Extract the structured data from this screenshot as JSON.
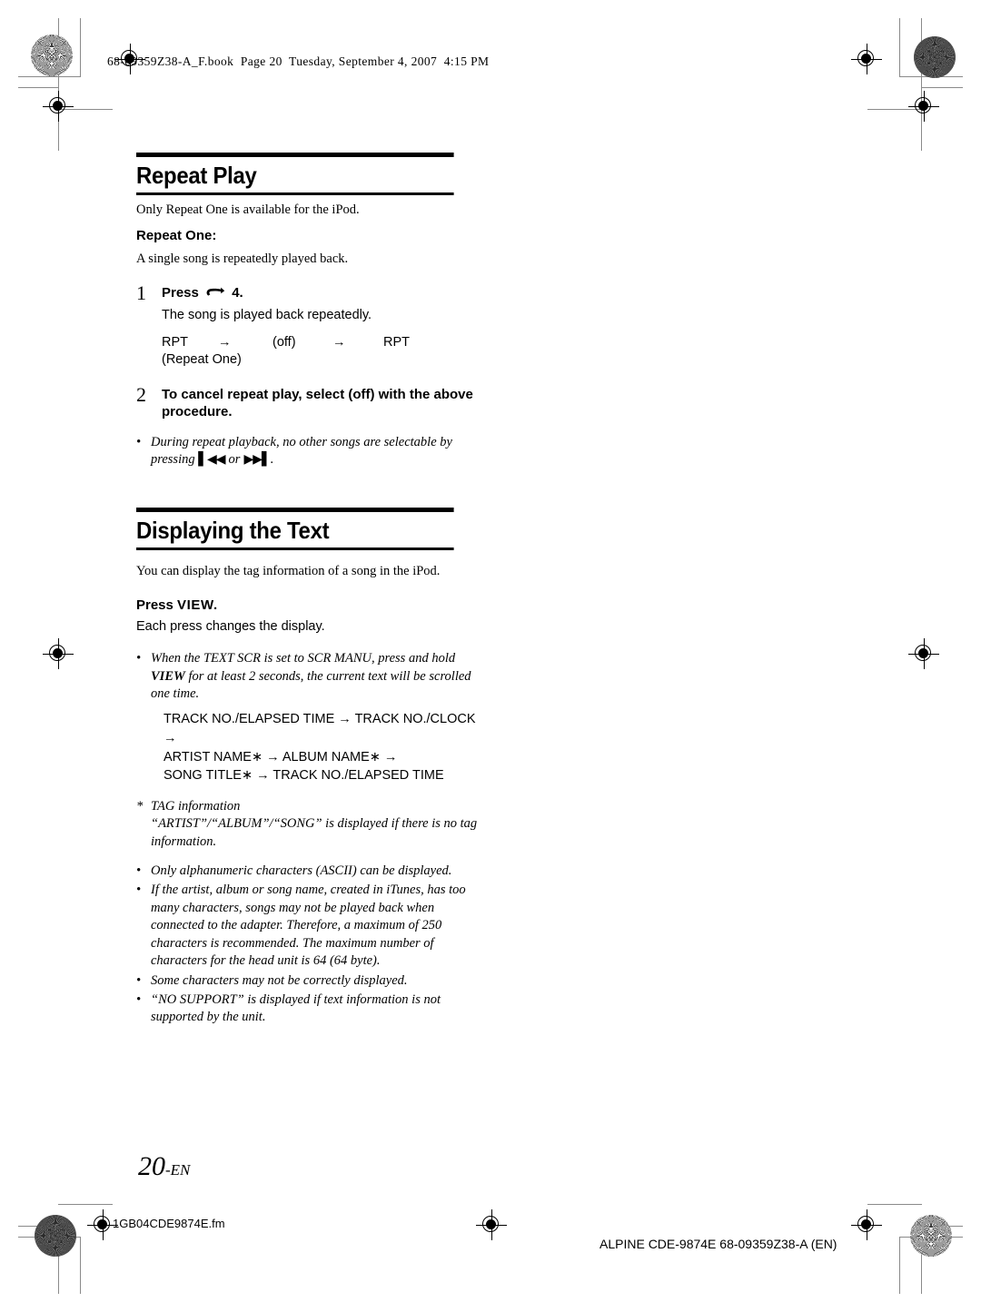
{
  "header": {
    "file_info": "68-09359Z38-A_F.book  Page 20  Tuesday, September 4, 2007  4:15 PM"
  },
  "sections": [
    {
      "title": "Repeat Play",
      "intro": "Only Repeat One is available for the iPod.",
      "subhead": "Repeat One:",
      "subhead_desc": "A single song is repeatedly played back.",
      "steps": [
        {
          "number": "1",
          "head_before_icon": "Press",
          "icon": "repeat-loop-icon",
          "head_after_icon": "4.",
          "sub": "The song is played back repeatedly.",
          "sequence": {
            "row1": [
              "RPT",
              "→",
              "(off)",
              "→",
              "RPT"
            ],
            "row2": "(Repeat One)"
          }
        },
        {
          "number": "2",
          "head": "To cancel repeat play, select (off) with the above procedure."
        }
      ],
      "notes": [
        {
          "mark": "•",
          "text_before_glyphs": "During repeat playback, no other songs are selectable by pressing ",
          "glyph_prev": "▌◀◀",
          "glyph_or": "or",
          "glyph_next": "▶▶▌",
          "text_after_glyphs": "."
        }
      ]
    },
    {
      "title": "Displaying the Text",
      "intro": "You can display the tag information of a song in the iPod.",
      "press_label_1": "Press ",
      "press_label_2": "VIEW.",
      "press_desc": "Each press changes the display.",
      "scroll_note": {
        "mark": "•",
        "part1": "When the TEXT SCR is set to SCR MANU, press and hold ",
        "bold": "VIEW",
        "part2": " for at least 2 seconds, the current text will be scrolled one time."
      },
      "display_sequence": [
        "TRACK NO./ELAPSED TIME → TRACK NO./CLOCK →",
        "ARTIST NAME∗ → ALBUM NAME∗ →",
        "SONG TITLE∗ → TRACK NO./ELAPSED TIME"
      ],
      "footnote": {
        "mark": "*",
        "line1": "TAG information",
        "line2": "“ARTIST”/“ALBUM”/“SONG” is displayed if there is no tag information."
      },
      "notes": [
        {
          "mark": "•",
          "text": "Only alphanumeric characters (ASCII) can be displayed."
        },
        {
          "mark": "•",
          "text": "If the artist, album or song name, created in iTunes, has too many characters, songs may not be played back when connected to the adapter. Therefore, a maximum of 250 characters is recommended. The maximum number of characters for the head unit is 64 (64 byte)."
        },
        {
          "mark": "•",
          "text": "Some characters may not be correctly displayed."
        },
        {
          "mark": "•",
          "text": "“NO SUPPORT” is displayed if text information is not supported by the unit."
        }
      ]
    }
  ],
  "page_number": {
    "value": "20",
    "suffix": "-EN"
  },
  "footer": {
    "source_file": "1GB04CDE9874E.fm",
    "document_id": "ALPINE CDE-9874E 68-09359Z38-A (EN)"
  }
}
